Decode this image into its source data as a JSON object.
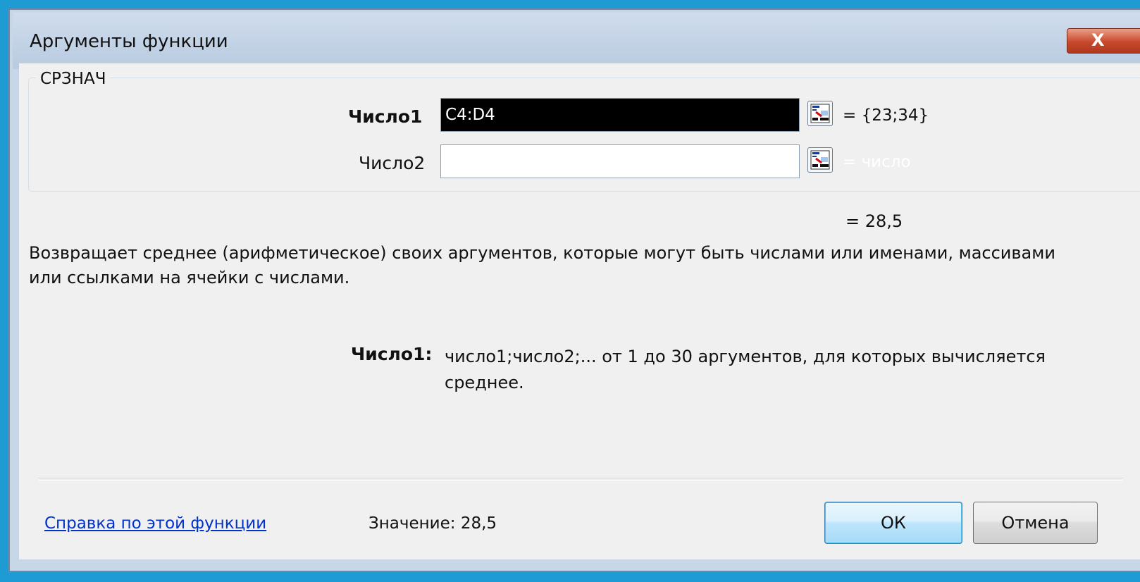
{
  "window": {
    "title": "Аргументы функции",
    "close_label": "X"
  },
  "function_group": {
    "name": "СРЗНАЧ",
    "args": [
      {
        "label": "Число1",
        "value": "C4:D4",
        "result": "= {23;34}"
      },
      {
        "label": "Число2",
        "value": "",
        "result": "= число"
      }
    ]
  },
  "result": "= 28,5",
  "description": "Возвращает среднее (арифметическое) своих аргументов, которые могут быть числами или именами, массивами или ссылками на ячейки с числами.",
  "arg_help": {
    "name": "Число1:",
    "text": "число1;число2;... от 1 до 30 аргументов, для которых вычисляется среднее."
  },
  "footer": {
    "help_link": "Справка по этой функции",
    "value_label": "Значение:",
    "value": "28,5",
    "ok_label": "ОК",
    "cancel_label": "Отмена"
  },
  "colors": {
    "link": "#0033cc",
    "close_button": "#c8482c",
    "selection": "#000000"
  }
}
